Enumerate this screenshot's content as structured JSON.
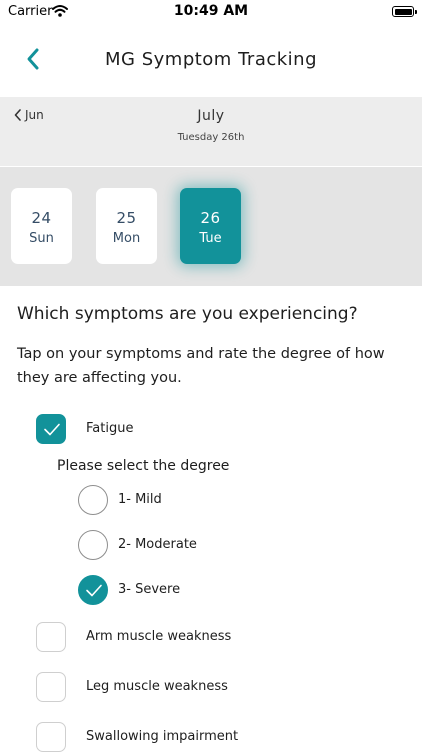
{
  "status_bar": {
    "carrier": "Carrier",
    "time": "10:49 AM",
    "wifi_icon": "wifi-icon",
    "battery_icon": "battery-icon"
  },
  "nav": {
    "title": "MG Symptom Tracking",
    "back_icon": "chevron-left-icon"
  },
  "calendar": {
    "prev_month_label": "Jun",
    "month": "July",
    "selected_date_label": "Tuesday 26th",
    "days": [
      {
        "number": "24",
        "weekday": "Sun",
        "selected": false
      },
      {
        "number": "25",
        "weekday": "Mon",
        "selected": false
      },
      {
        "number": "26",
        "weekday": "Tue",
        "selected": true
      }
    ]
  },
  "form": {
    "question": "Which symptoms are you experiencing?",
    "instructions": "Tap on your symptoms and rate the degree of how they are affecting you.",
    "degree_prompt": "Please select the degree",
    "symptoms": [
      {
        "label": "Fatigue",
        "checked": true
      },
      {
        "label": "Arm muscle weakness",
        "checked": false
      },
      {
        "label": "Leg muscle weakness",
        "checked": false
      },
      {
        "label": "Swallowing impairment",
        "checked": false
      }
    ],
    "degrees": [
      {
        "label": "1- Mild",
        "selected": false
      },
      {
        "label": "2- Moderate",
        "selected": false
      },
      {
        "label": "3- Severe",
        "selected": true
      }
    ]
  },
  "colors": {
    "accent": "#12929a",
    "header_bg": "#ededed",
    "week_strip_bg": "#e4e4e4",
    "day_text": "#354d66"
  }
}
